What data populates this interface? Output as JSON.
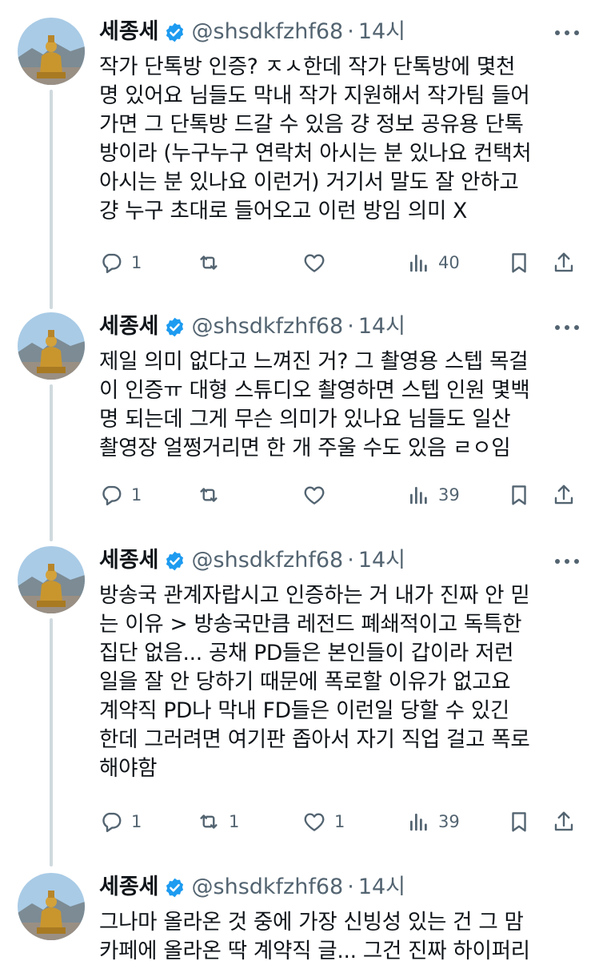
{
  "tweets": [
    {
      "name": "세종세",
      "handle": "@shsdkfzhf68",
      "separator": "·",
      "time": "14시",
      "text": "작가 단톡방 인증? ㅈㅅ한데 작가 단톡방에 몇천\n명 있어요 님들도 막내 작가 지원해서 작가팀 들어\n가면 그 단톡방 드갈 수 있음 걍 정보 공유용 단톡\n방이라 (누구누구 연락처 아시는 분 있나요 컨택처\n아시는 분 있나요 이런거) 거기서 말도 잘 안하고\n걍 누구 초대로 들어오고 이런 방임 의미 X",
      "replies": "1",
      "retweets": "",
      "likes": "",
      "views": "40"
    },
    {
      "name": "세종세",
      "handle": "@shsdkfzhf68",
      "separator": "·",
      "time": "14시",
      "text": "제일 의미 없다고 느껴진 거? 그 촬영용 스텝 목걸\n이 인증ㅠ 대형 스튜디오 촬영하면 스텝 인원 몇백\n명 되는데 그게 무슨 의미가 있나요 님들도 일산\n촬영장 얼쩡거리면 한 개 주울 수도 있음 ㄹㅇ임",
      "replies": "1",
      "retweets": "",
      "likes": "",
      "views": "39"
    },
    {
      "name": "세종세",
      "handle": "@shsdkfzhf68",
      "separator": "·",
      "time": "14시",
      "text": "방송국 관계자랍시고 인증하는 거 내가 진짜 안 믿\n는 이유 > 방송국만큼 레전드 폐쇄적이고 독특한\n집단 없음... 공채 PD들은 본인들이 갑이라 저런\n일을 잘 안 당하기 때문에 폭로할 이유가 없고요\n계약직 PD나 막내 FD들은 이런일 당할 수 있긴\n한데 그러려면 여기판 좁아서 자기 직업 걸고 폭로\n해야함",
      "replies": "1",
      "retweets": "1",
      "likes": "1",
      "views": "39"
    },
    {
      "name": "세종세",
      "handle": "@shsdkfzhf68",
      "separator": "·",
      "time": "14시",
      "text": "그나마 올라온 것 중에 가장 신빙성 있는 건 그 맘\n카페에 올라온 딱 계약직 글... 그건 진짜 하이퍼리"
    }
  ],
  "icons": {
    "reply": "reply-icon",
    "retweet": "retweet-icon",
    "like": "heart-icon",
    "views": "views-icon",
    "bookmark": "bookmark-icon",
    "share": "share-icon",
    "verified": "verified-badge-icon",
    "more": "more-icon"
  },
  "colors": {
    "text": "#0f1419",
    "muted": "#536471",
    "verified": "#1d9bf0",
    "thread_line": "#cfd9de"
  }
}
